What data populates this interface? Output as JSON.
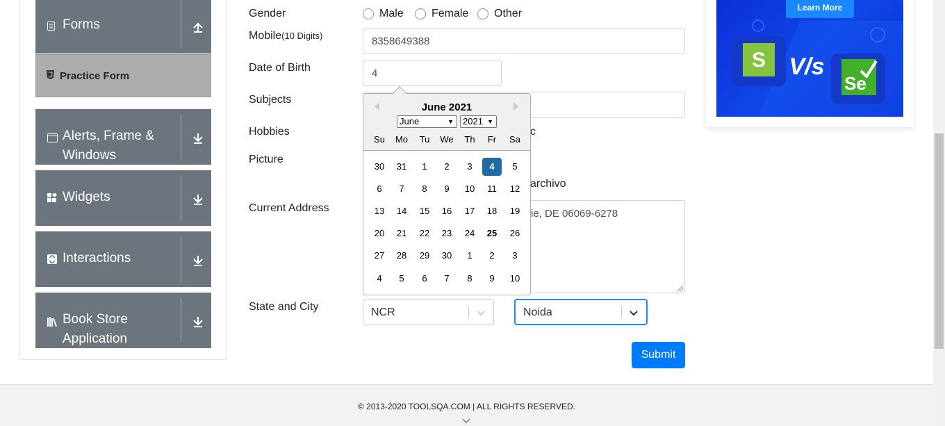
{
  "sidebar": {
    "groups": [
      {
        "label": "Forms",
        "icon": "document-icon",
        "arrow": "up"
      },
      {
        "label": "Alerts, Frame & Windows",
        "icon": "window-icon",
        "arrow": "down"
      },
      {
        "label": "Widgets",
        "icon": "widgets-icon",
        "arrow": "down"
      },
      {
        "label": "Interactions",
        "icon": "interactions-icon",
        "arrow": "down"
      },
      {
        "label": "Book Store Application",
        "icon": "books-icon",
        "arrow": "down"
      }
    ],
    "active_item": {
      "label": "Practice Form",
      "icon": "html5-icon"
    }
  },
  "form": {
    "gender": {
      "label": "Gender",
      "options": [
        "Male",
        "Female",
        "Other"
      ]
    },
    "mobile": {
      "label": "Mobile",
      "hint": "(10 Digits)",
      "value": "8358649388"
    },
    "dob": {
      "label": "Date of Birth",
      "value": "4"
    },
    "subjects": {
      "label": "Subjects"
    },
    "hobbies": {
      "label": "Hobbies",
      "partial_text": "c"
    },
    "picture": {
      "label": "Picture",
      "partial_text": "archivo"
    },
    "current_address": {
      "label": "Current Address",
      "partial_value": "ie, DE 06069-6278"
    },
    "state_city": {
      "label": "State and City",
      "state": "NCR",
      "city": "Noida"
    },
    "submit_label": "Submit"
  },
  "datepicker": {
    "title": "June 2021",
    "month_select": "June",
    "year_select": "2021",
    "day_names": [
      "Su",
      "Mo",
      "Tu",
      "We",
      "Th",
      "Fr",
      "Sa"
    ],
    "weeks": [
      [
        "30",
        "31",
        "1",
        "2",
        "3",
        "4",
        "5"
      ],
      [
        "6",
        "7",
        "8",
        "9",
        "10",
        "11",
        "12"
      ],
      [
        "13",
        "14",
        "15",
        "16",
        "17",
        "18",
        "19"
      ],
      [
        "20",
        "21",
        "22",
        "23",
        "24",
        "25",
        "26"
      ],
      [
        "27",
        "28",
        "29",
        "30",
        "1",
        "2",
        "3"
      ],
      [
        "4",
        "5",
        "6",
        "7",
        "8",
        "9",
        "10"
      ]
    ],
    "selected_day": "4",
    "today_day": "25"
  },
  "ad": {
    "button_label": "Learn More",
    "vs_text": "V/s",
    "se_text": "Se"
  },
  "footer": {
    "text": "© 2013-2020 TOOLSQA.COM | ALL RIGHTS RESERVED."
  },
  "colors": {
    "primary": "#007bff",
    "sidebar_bg": "#6c757d",
    "selected_day": "#216ba5",
    "ad_blue": "#1046e8"
  }
}
